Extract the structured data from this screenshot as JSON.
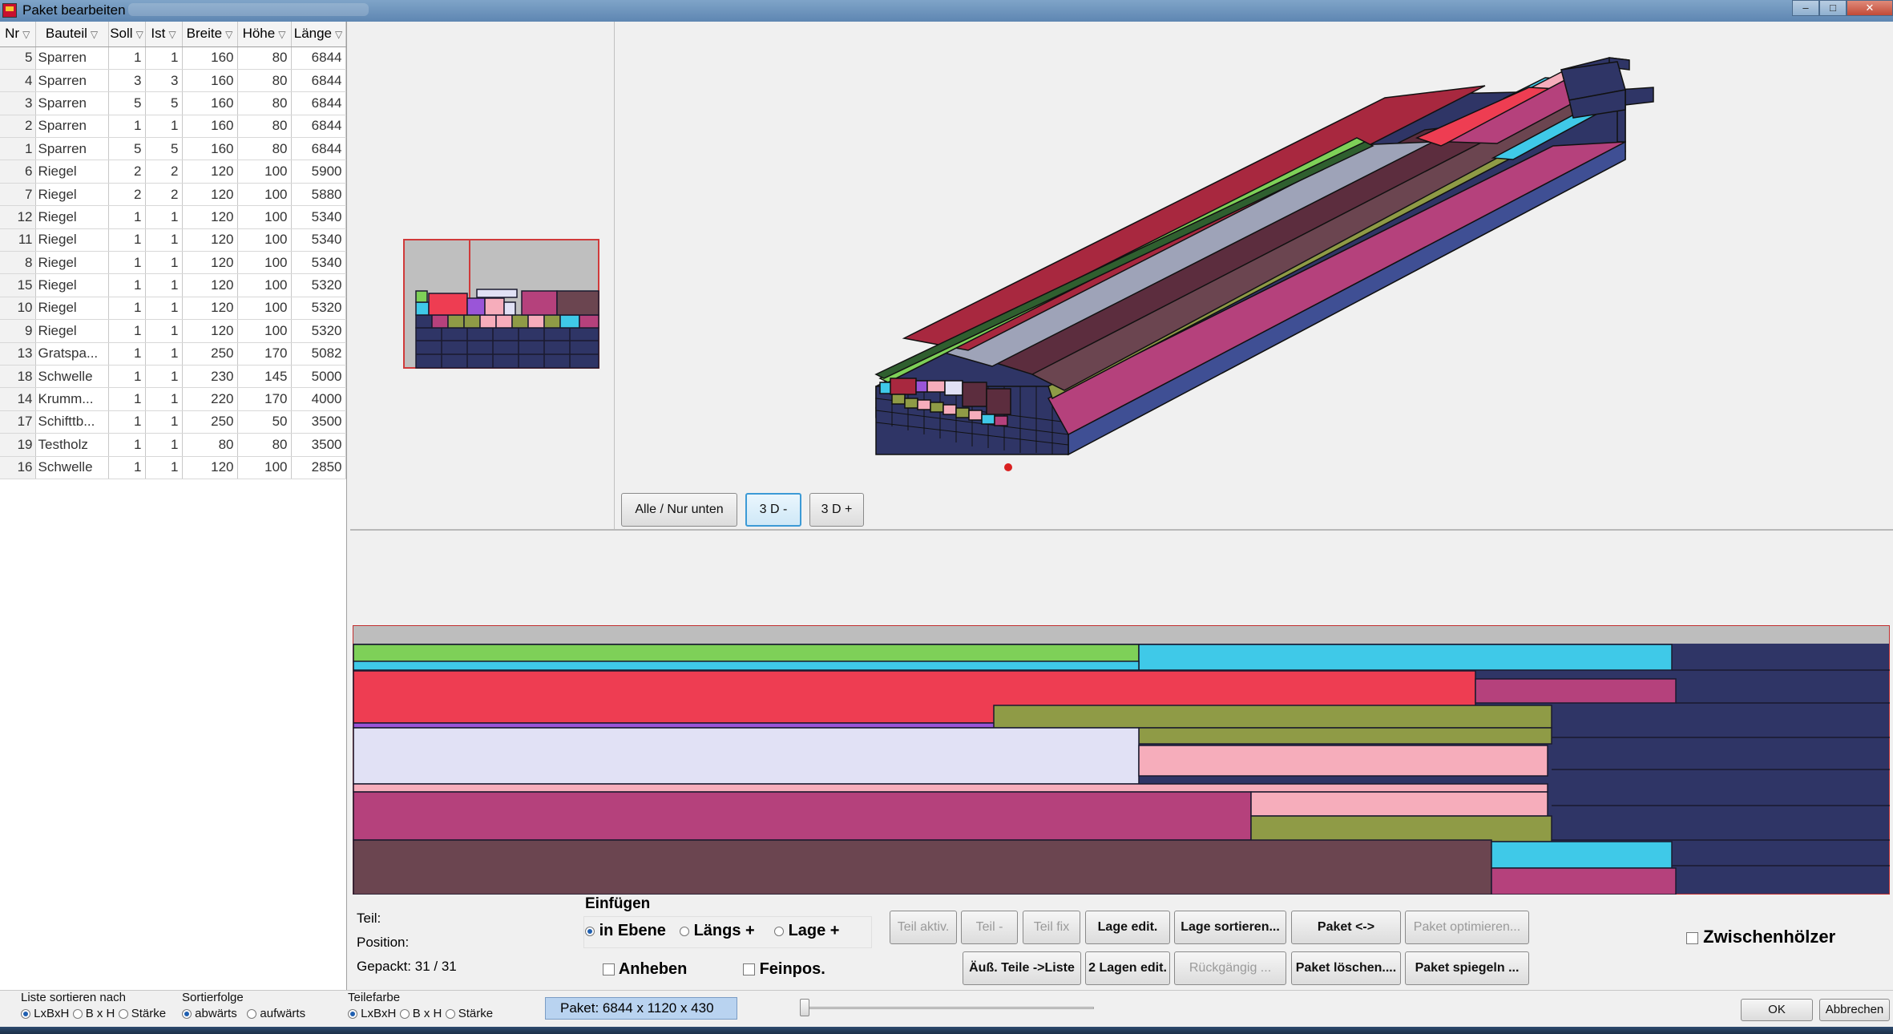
{
  "window": {
    "title": "Paket bearbeiten"
  },
  "table": {
    "headers": [
      "Nr",
      "Bauteil",
      "Soll",
      "Ist",
      "Breite",
      "Höhe",
      "Länge"
    ],
    "rows": [
      [
        "5",
        "Sparren",
        "1",
        "1",
        "160",
        "80",
        "6844"
      ],
      [
        "4",
        "Sparren",
        "3",
        "3",
        "160",
        "80",
        "6844"
      ],
      [
        "3",
        "Sparren",
        "5",
        "5",
        "160",
        "80",
        "6844"
      ],
      [
        "2",
        "Sparren",
        "1",
        "1",
        "160",
        "80",
        "6844"
      ],
      [
        "1",
        "Sparren",
        "5",
        "5",
        "160",
        "80",
        "6844"
      ],
      [
        "6",
        "Riegel",
        "2",
        "2",
        "120",
        "100",
        "5900"
      ],
      [
        "7",
        "Riegel",
        "2",
        "2",
        "120",
        "100",
        "5880"
      ],
      [
        "12",
        "Riegel",
        "1",
        "1",
        "120",
        "100",
        "5340"
      ],
      [
        "11",
        "Riegel",
        "1",
        "1",
        "120",
        "100",
        "5340"
      ],
      [
        "8",
        "Riegel",
        "1",
        "1",
        "120",
        "100",
        "5340"
      ],
      [
        "15",
        "Riegel",
        "1",
        "1",
        "120",
        "100",
        "5320"
      ],
      [
        "10",
        "Riegel",
        "1",
        "1",
        "120",
        "100",
        "5320"
      ],
      [
        "9",
        "Riegel",
        "1",
        "1",
        "120",
        "100",
        "5320"
      ],
      [
        "13",
        "Gratspa...",
        "1",
        "1",
        "250",
        "170",
        "5082"
      ],
      [
        "18",
        "Schwelle",
        "1",
        "1",
        "230",
        "145",
        "5000"
      ],
      [
        "14",
        "Krumm...",
        "1",
        "1",
        "220",
        "170",
        "4000"
      ],
      [
        "17",
        "Schifttb...",
        "1",
        "1",
        "250",
        "50",
        "3500"
      ],
      [
        "19",
        "Testholz",
        "1",
        "1",
        "80",
        "80",
        "3500"
      ],
      [
        "16",
        "Schwelle",
        "1",
        "1",
        "120",
        "100",
        "2850"
      ]
    ]
  },
  "view_buttons": {
    "alle": "Alle / Nur unten",
    "minus": "3 D -",
    "plus": "3 D +"
  },
  "info": {
    "teil": "Teil:",
    "position": "Position:",
    "gepackt": "Gepackt: 31 / 31"
  },
  "einfuegen": {
    "title": "Einfügen",
    "options": [
      "in Ebene",
      "Längs +",
      "Lage +"
    ],
    "selected": "in Ebene",
    "anheben": "Anheben",
    "feinpos": "Feinpos."
  },
  "buttons_row1": {
    "teil_aktiv": "Teil aktiv.",
    "teil_minus": "Teil -",
    "teil_fix": "Teil fix",
    "lage_edit": "Lage edit.",
    "lage_sortieren": "Lage sortieren...",
    "paket_swap": "Paket <->",
    "paket_optimieren": "Paket optimieren..."
  },
  "buttons_row2": {
    "aeuss_teile": "Äuß. Teile ->Liste",
    "zwei_lagen": "2 Lagen edit.",
    "rueckgaengig": "Rückgängig ...",
    "paket_loeschen": "Paket löschen....",
    "paket_spiegeln": "Paket spiegeln ..."
  },
  "zwischenhoelzer": "Zwischenhölzer",
  "sort": {
    "title": "Liste sortieren nach",
    "options": [
      "LxBxH",
      "B x H",
      "Stärke"
    ],
    "selected": "LxBxH"
  },
  "sortierfolge": {
    "title": "Sortierfolge",
    "options": [
      "abwärts",
      "aufwärts"
    ],
    "selected": "abwärts"
  },
  "teilefarbe": {
    "title": "Teilefarbe",
    "options": [
      "LxBxH",
      "B x H",
      "Stärke"
    ],
    "selected": "LxBxH"
  },
  "status": {
    "paket": "Paket: 6844 x 1120 x 430"
  },
  "dialog_buttons": {
    "ok": "OK",
    "abbrechen": "Abbrechen"
  },
  "colors": {
    "navy": "#2f3566",
    "green": "#7ed058",
    "cyan": "#3fc9e8",
    "red": "#ee3d52",
    "magenta": "#b5417c",
    "olive": "#8f9b46",
    "pink": "#f6adbb",
    "lavender": "#e1e1f5",
    "brown": "#6b4550",
    "purple": "#9a55d8",
    "grey": "#bdbdbd"
  }
}
